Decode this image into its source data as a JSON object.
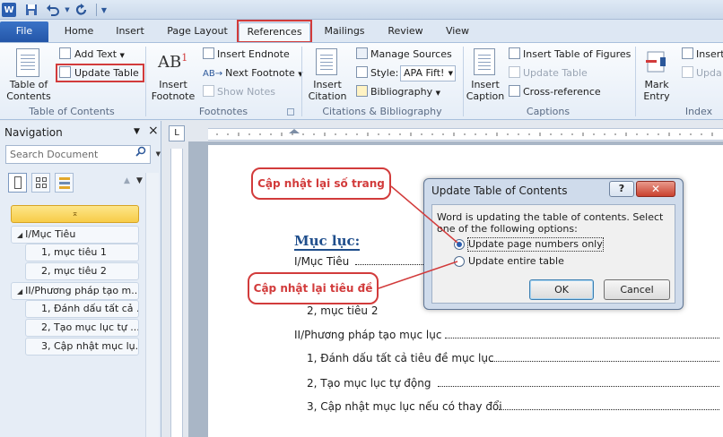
{
  "quick_access": {
    "word_icon": "W",
    "save_icon": "save-icon",
    "undo_icon": "undo-icon",
    "redo_icon": "redo-icon",
    "customize_icon": "customize-icon"
  },
  "ribbon_tabs": [
    {
      "label": "File"
    },
    {
      "label": "Home"
    },
    {
      "label": "Insert"
    },
    {
      "label": "Page Layout"
    },
    {
      "label": "References"
    },
    {
      "label": "Mailings"
    },
    {
      "label": "Review"
    },
    {
      "label": "View"
    }
  ],
  "ribbon": {
    "toc_group": {
      "toc_button": "Table of\nContents",
      "add_text": "Add Text",
      "update_table": "Update Table",
      "label": "Table of Contents"
    },
    "footnotes_group": {
      "insert_footnote": "Insert\nFootnote",
      "insert_endnote": "Insert Endnote",
      "next_footnote": "Next Footnote",
      "show_notes": "Show Notes",
      "label": "Footnotes",
      "ab_glyph": "AB",
      "ab_sup": "1"
    },
    "citations_group": {
      "insert_citation": "Insert\nCitation",
      "manage_sources": "Manage Sources",
      "style_label": "Style:",
      "style_value": "APA Fift!",
      "bibliography": "Bibliography",
      "label": "Citations & Bibliography"
    },
    "captions_group": {
      "insert_caption": "Insert\nCaption",
      "insert_table_of_figures": "Insert Table of Figures",
      "update_table": "Update Table",
      "cross_reference": "Cross-reference",
      "label": "Captions"
    },
    "index_group": {
      "mark_entry": "Mark\nEntry",
      "insert_index": "Insert",
      "update_index": "Upda",
      "label": "Index"
    }
  },
  "navigation": {
    "title": "Navigation",
    "search_placeholder": "Search Document",
    "collapse_glyph": "▼",
    "close_glyph": "×",
    "up_glyph": "▲",
    "down_glyph": "▼",
    "top_marker": "⌅",
    "items": [
      {
        "label": "I/Mục Tiêu",
        "level": 1
      },
      {
        "label": "1, mục tiêu  1",
        "level": 2
      },
      {
        "label": "2, mục tiêu 2",
        "level": 2
      },
      {
        "label": "II/Phương pháp tạo m...",
        "level": 1
      },
      {
        "label": "1, Đánh dấu tất cả ...",
        "level": 2
      },
      {
        "label": "2,  Tạo mục lục tự ...",
        "level": 2
      },
      {
        "label": "3, Cập nhật mục lụ...",
        "level": 2
      }
    ]
  },
  "ruler": {
    "corner_glyph": "L"
  },
  "document": {
    "heading": "Mục lục:",
    "toc_lines": [
      "I/Mục Tiêu",
      "2, mục tiêu 2",
      "II/Phương pháp tạo mục lục",
      "1, Đánh dấu tất cả tiêu đề mục lục",
      "2,  Tạo mục lục tự động ",
      "3, Cập nhật mục lục nếu có thay đổi"
    ]
  },
  "dialog": {
    "title": "Update Table of Contents",
    "help": "?",
    "close": "✕",
    "message": "Word is updating the table of contents.  Select one of the following options:",
    "options": [
      {
        "label": "Update page numbers only",
        "selected": true
      },
      {
        "label": "Update entire table",
        "selected": false
      }
    ],
    "ok": "OK",
    "cancel": "Cancel"
  },
  "callouts": {
    "page_numbers": "Cập nhật lại số trang",
    "headings": "Cập nhật lại tiêu đề"
  },
  "colors": {
    "accent": "#2b579a",
    "highlight": "#d23b3b",
    "heading": "#1f4e8c"
  }
}
